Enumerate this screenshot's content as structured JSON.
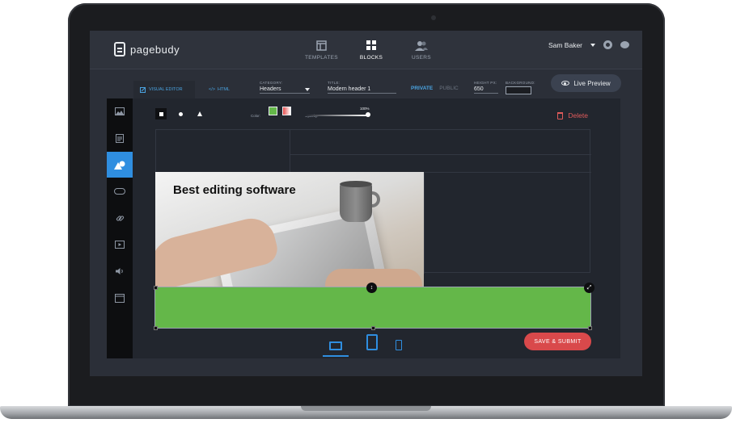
{
  "app": {
    "name": "pagebudy"
  },
  "nav": {
    "items": [
      {
        "label": "TEMPLATES",
        "icon": "templates-icon",
        "active": false
      },
      {
        "label": "BLOCKS",
        "icon": "blocks-icon",
        "active": true
      },
      {
        "label": "USERS",
        "icon": "users-icon",
        "active": false
      }
    ]
  },
  "user": {
    "name": "Sam Baker"
  },
  "toolbar": {
    "visual_editor_label": "VISUAL EDITOR",
    "html_label": "HTML",
    "category_label": "CATEGORY:",
    "category_value": "Headers",
    "title_label": "TITLE:",
    "title_value": "Modern header 1",
    "private_label": "PRIVATE",
    "public_label": "PUBLIC",
    "height_label": "HEIGHT PX:",
    "height_value": "650",
    "background_label": "BACKGROUND:",
    "live_preview_label": "Live Preview"
  },
  "sidebar": {
    "items": [
      {
        "icon": "image-icon",
        "active": false
      },
      {
        "icon": "text-icon",
        "active": false
      },
      {
        "icon": "shapes-icon",
        "active": true
      },
      {
        "icon": "button-icon",
        "active": false
      },
      {
        "icon": "link-icon",
        "active": false
      },
      {
        "icon": "video-icon",
        "active": false
      },
      {
        "icon": "audio-icon",
        "active": false
      },
      {
        "icon": "window-icon",
        "active": false
      }
    ]
  },
  "editor": {
    "color_label": "Color:",
    "colors": [
      "#64b749",
      "#e64a4a"
    ],
    "opacity_label": "Opacity:",
    "opacity_value": "100%",
    "delete_label": "Delete",
    "hero_title": "Best editing software",
    "block_color": "#64b749",
    "save_label": "SAVE & SUBMIT"
  },
  "colors": {
    "accent": "#2f8ee0",
    "danger": "#d9494b",
    "background": "#2b2f38"
  }
}
